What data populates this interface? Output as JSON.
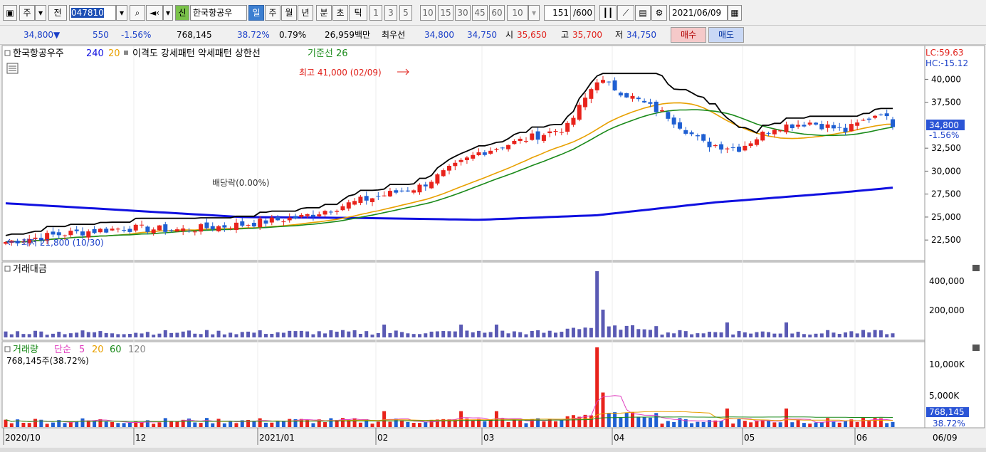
{
  "toolbar": {
    "cur_mode": "주",
    "prev_label": "전",
    "code": "047810",
    "stock_name": "한국항공우",
    "new_badge": "신",
    "periods": [
      "일",
      "주",
      "월",
      "년",
      "분",
      "초",
      "틱"
    ],
    "selected_period": "일",
    "numbers": [
      "1",
      "3",
      "5",
      "10",
      "15",
      "30",
      "45",
      "60"
    ],
    "interval_value": "10",
    "count_value": "151",
    "count_total": "/600",
    "date_value": "2021/06/09"
  },
  "quote": {
    "price": "34,800",
    "arrow": "▼",
    "change": "550",
    "change_pct": "-1.56%",
    "volume": "768,145",
    "vol_ratio": "38.72%",
    "turnover": "0.79%",
    "amount": "26,959백만",
    "best_label": "최우선",
    "ask": "34,800",
    "bid": "34,750",
    "open_label": "시",
    "open": "35,650",
    "high_label": "고",
    "high": "35,700",
    "low_label": "저",
    "low": "34,750",
    "buy_label": "매수",
    "sell_label": "매도"
  },
  "price_panel": {
    "name": "한국항공우주",
    "ma240": "240",
    "ma20": "20",
    "indicators": "이격도 강세패턴  약세패턴  상한선",
    "base_line": "기준선 26",
    "lc": "LC:59.63",
    "hc": "HC:-15.12",
    "high_marker": "최고 41,000 (02/09)",
    "low_marker": "최저 21,800 (10/30)",
    "dividend_marker": "배당락(0.00%)",
    "current_price": "34,800",
    "current_change": "-1.56%",
    "y_ticks": [
      "40,000",
      "37,500",
      "32,500",
      "30,000",
      "27,500",
      "25,000",
      "22,500"
    ]
  },
  "amount_panel": {
    "title": "거래대금",
    "y_ticks": [
      "400,000",
      "200,000"
    ]
  },
  "volume_panel": {
    "title": "거래량",
    "ma_label": "단순",
    "ma_values": [
      "5",
      "20",
      "60",
      "120"
    ],
    "sub_label": "768,145주(38.72%)",
    "y_ticks": [
      "10,000K",
      "5,000K"
    ],
    "current_value": "768,145",
    "current_pct": "38.72%"
  },
  "x_axis": {
    "labels": [
      "2020/10",
      "12",
      "2021/01",
      "02",
      "03",
      "04",
      "05",
      "06"
    ],
    "last_label": "06/09"
  },
  "colors": {
    "up": "#e8231c",
    "down": "#1f5fd2",
    "ma_black": "#000000",
    "ma_green": "#1a8a1a",
    "ma_orange": "#e8a000",
    "ma240": "#1010e0",
    "vol_pink": "#e040c0"
  },
  "chart_data": {
    "type": "candlestick",
    "x_range": [
      "2020/10",
      "2021/06/09"
    ],
    "price_ylim": [
      20500,
      42200
    ],
    "markers": {
      "high": {
        "value": 41000,
        "date": "02/09"
      },
      "low": {
        "value": 21800,
        "date": "10/30"
      }
    },
    "last": {
      "close": 34800,
      "open": 35650,
      "high": 35700,
      "low": 34750,
      "volume": 768145
    },
    "close_series_anchors": [
      [
        "2020/10",
        22300
      ],
      [
        "2020/11",
        23500
      ],
      [
        "2020/12",
        24000
      ],
      [
        "2020/12 mid",
        24800
      ],
      [
        "2021/01",
        26500
      ],
      [
        "2021/01 mid",
        29000
      ],
      [
        "2021/01 end",
        33000
      ],
      [
        "2021/02",
        34500
      ],
      [
        "2021/02/09",
        40000
      ],
      [
        "2021/02 end",
        36500
      ],
      [
        "2021/03",
        33000
      ],
      [
        "2021/03 end",
        35500
      ],
      [
        "2021/04",
        37000
      ],
      [
        "2021/04 end",
        34000
      ],
      [
        "2021/05",
        31500
      ],
      [
        "2021/05 mid",
        30800
      ],
      [
        "2021/06",
        33500
      ],
      [
        "2021/06/09",
        34800
      ]
    ]
  }
}
